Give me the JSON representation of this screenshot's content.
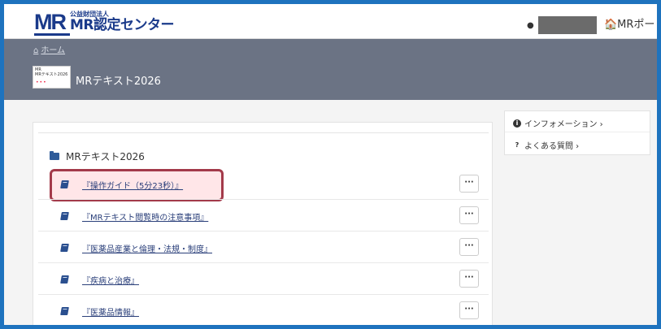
{
  "header": {
    "logo_mark": "MR",
    "logo_small": "公益財団法人",
    "logo_big": "MR認定センター",
    "user_icon": "user-icon",
    "portal_link": "🏠MRポー"
  },
  "banner": {
    "breadcrumb_home": "ホーム",
    "thumb_text": "MR\nMRテキスト2026",
    "course_title": "MRテキスト2026"
  },
  "course": {
    "section_title": "MRテキスト2026",
    "items": [
      {
        "label": "『操作ガイド（5分23秒）』",
        "menu": "···"
      },
      {
        "label": "『MRテキスト閲覧時の注意事項』",
        "menu": "···"
      },
      {
        "label": "『医薬品産業と倫理・法規・制度』",
        "menu": "···"
      },
      {
        "label": "『疾病と治療』",
        "menu": "···"
      },
      {
        "label": "『医薬品情報』",
        "menu": "···"
      }
    ]
  },
  "side_panel": {
    "info_label": "インフォメーション ›",
    "faq_label": "よくある質問 ›"
  },
  "colors": {
    "frame": "#1e73be",
    "banner": "#6b7384",
    "highlight": "#a33a4a",
    "brand": "#1a3a8a"
  }
}
